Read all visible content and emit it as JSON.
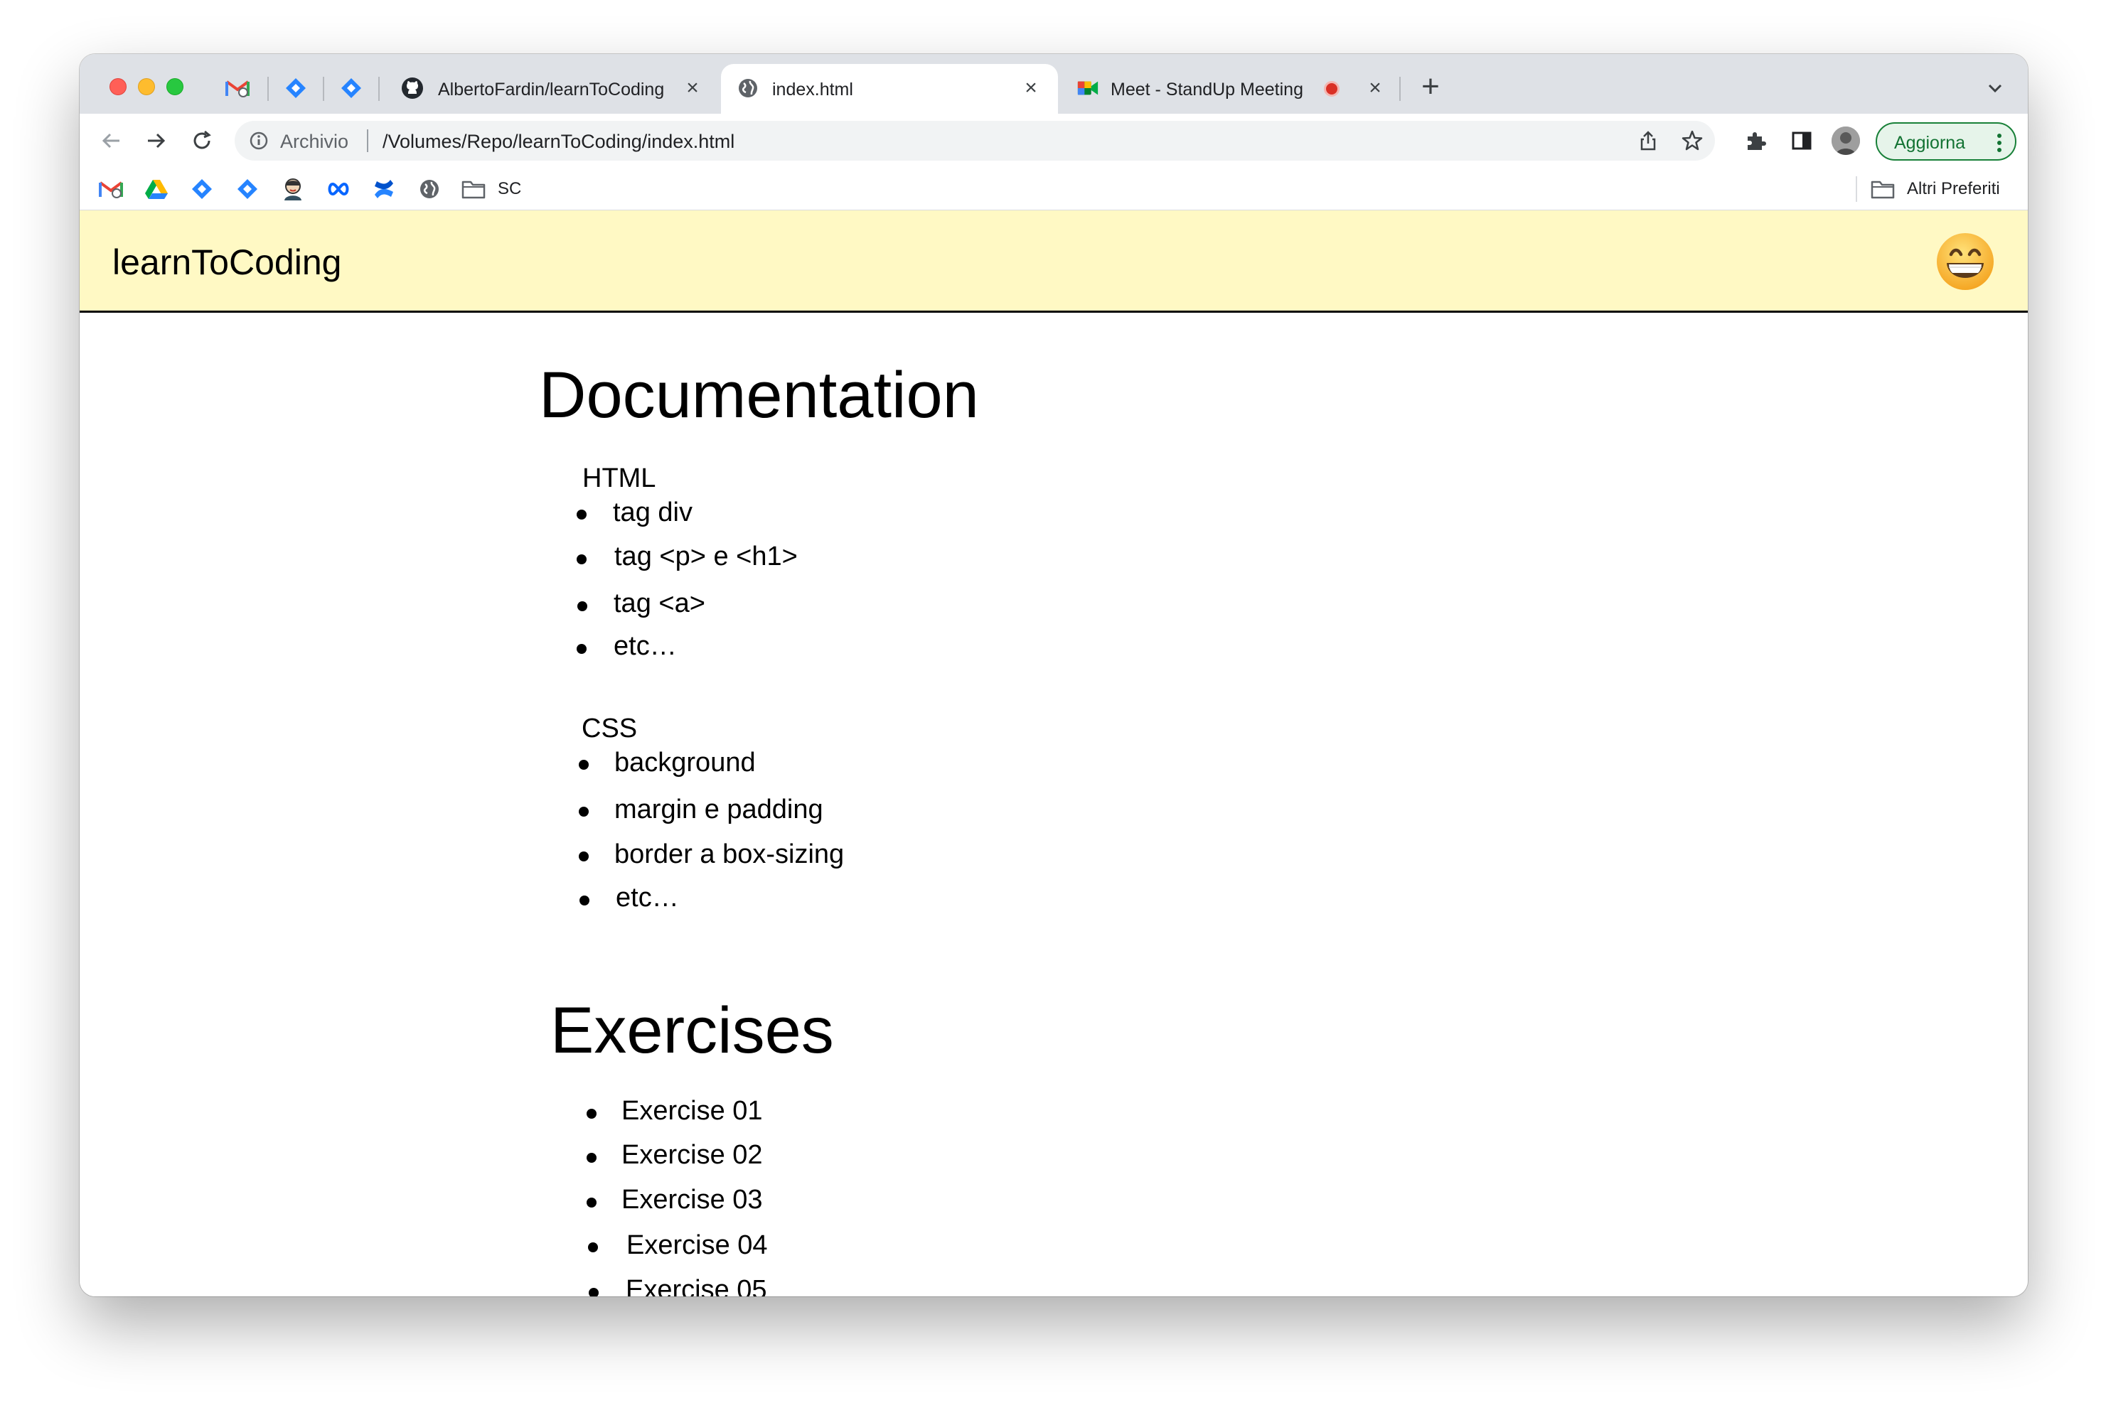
{
  "browser": {
    "tabs": [
      {
        "title": "AlbertoFardin/learnToCoding",
        "active": false
      },
      {
        "title": "index.html",
        "active": true
      },
      {
        "title": "Meet - StandUp Meeting",
        "active": false
      }
    ],
    "address": {
      "scheme_label": "Archivio",
      "url": "/Volumes/Repo/learnToCoding/index.html"
    },
    "update_button": "Aggiorna",
    "bookmarks": {
      "folder_label": "SC",
      "other_bookmarks": "Altri Preferiti"
    },
    "colors": {
      "tabstrip": "#dee1e6",
      "update_green": "#137333",
      "recording_red": "#d93025"
    }
  },
  "page": {
    "site_title": "learnToCoding",
    "header_bg": "#fff9c4",
    "avatar_icon": "smiley-face-icon",
    "documentation": {
      "heading": "Documentation",
      "html": {
        "title": "HTML",
        "items": [
          "tag div",
          "tag <p> e <h1>",
          "tag <a>",
          "etc…"
        ]
      },
      "css": {
        "title": "CSS",
        "items": [
          "background",
          "margin e padding",
          "border a box-sizing",
          "etc…"
        ]
      }
    },
    "exercises": {
      "heading": "Exercises",
      "items": [
        "Exercise 01",
        "Exercise 02",
        "Exercise 03",
        "Exercise 04",
        "Exercise 05"
      ]
    }
  }
}
